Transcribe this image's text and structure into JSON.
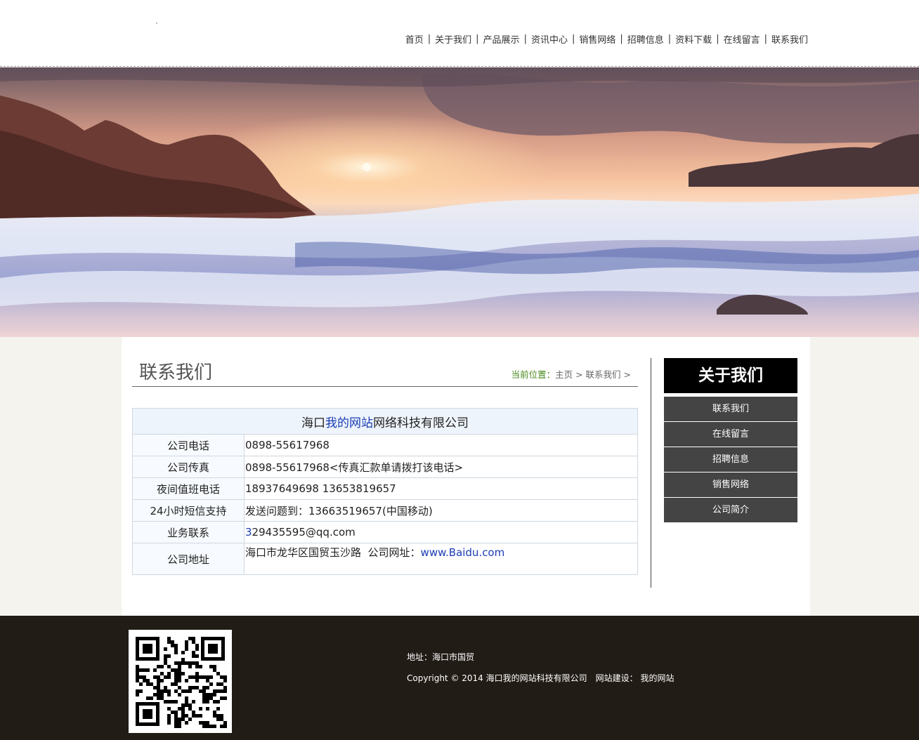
{
  "nav": {
    "items": [
      "首页",
      "关于我们",
      "产品展示",
      "资讯中心",
      "销售网络",
      "招聘信息",
      "资料下载",
      "在线留言",
      "联系我们"
    ],
    "separator": "|"
  },
  "main": {
    "title": "联系我们",
    "breadcrumb": {
      "label": "当前位置：",
      "home": "主页",
      "sep": " > ",
      "current": "联系我们",
      "trail": " >"
    }
  },
  "contact": {
    "company_prefix": "海口",
    "company_highlight": "我的网站",
    "company_suffix": "网络科技有限公司",
    "rows": [
      {
        "k": "公司电话",
        "v": "0898-55617968"
      },
      {
        "k": "公司传真",
        "v": "0898-55617968<传真汇款单请拨打该电话>"
      },
      {
        "k": "夜间值班电话",
        "v": "18937649698 13653819657"
      },
      {
        "k": "24小时短信支持",
        "v": "发送问题到：13663519657(中国移动)"
      }
    ],
    "business_label": "业务联系",
    "email_first": "3",
    "email_rest": "29435595@qq.com",
    "address_label": "公司地址",
    "address_text": "海口市龙华区国贸玉沙路  公司网址：",
    "website": "www.Baidu.com"
  },
  "sidebar": {
    "title": "关于我们",
    "items": [
      "联系我们",
      "在线留言",
      "招聘信息",
      "销售网络",
      "公司简介"
    ]
  },
  "footer": {
    "address": "地址：海口市国贸",
    "copyright": "Copyright © 2014 海口我的网站科技有限公司",
    "built_label": "网站建设：",
    "built_by": "我的网站"
  },
  "colors": {
    "footer_bg": "#221c16",
    "side_title_bg": "#000000",
    "side_item_bg": "#444444",
    "breadcrumb_label": "#4b8a1e",
    "link_blue": "#1a3db5"
  }
}
